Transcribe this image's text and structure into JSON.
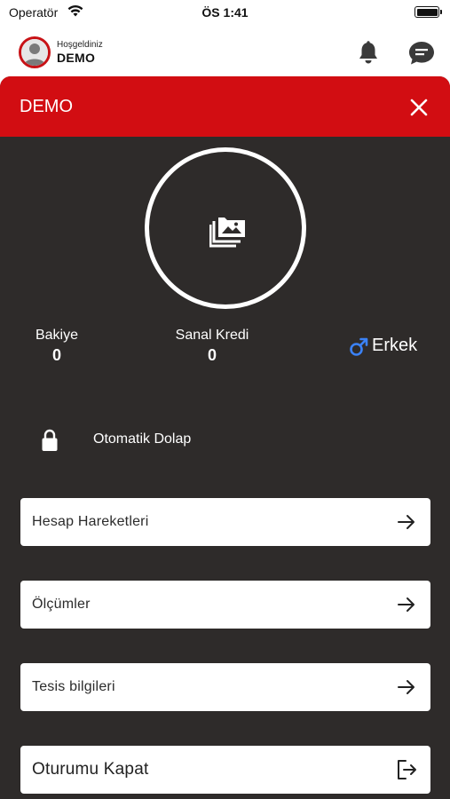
{
  "status_bar": {
    "carrier": "Operatör",
    "time": "ÖS 1:41",
    "icons": [
      "wifi-icon",
      "battery-icon"
    ]
  },
  "header": {
    "welcome": "Hoşgeldiniz",
    "user_name": "DEMO",
    "icons": [
      "avatar",
      "bell-icon",
      "chat-icon"
    ]
  },
  "panel": {
    "title": "DEMO",
    "close_icon": "close-icon",
    "photo_icon": "photo-library-icon",
    "stats": [
      {
        "label": "Bakiye",
        "value": "0"
      },
      {
        "label": "Sanal Kredi",
        "value": "0"
      }
    ],
    "gender": {
      "icon": "male-icon",
      "label": "Erkek"
    },
    "locker": {
      "icon": "lock-icon",
      "label": "Otomatik Dolap"
    },
    "menu": [
      {
        "label": "Hesap Hareketleri",
        "icon": "arrow-right-icon"
      },
      {
        "label": "Ölçümler",
        "icon": "arrow-right-icon"
      },
      {
        "label": "Tesis bilgileri",
        "icon": "arrow-right-icon"
      }
    ],
    "logout": {
      "label": "Oturumu Kapat",
      "icon": "logout-icon"
    }
  },
  "colors": {
    "brand_red": "#d20d12",
    "panel_bg": "#2e2b2a",
    "male_blue": "#3b82f6"
  }
}
